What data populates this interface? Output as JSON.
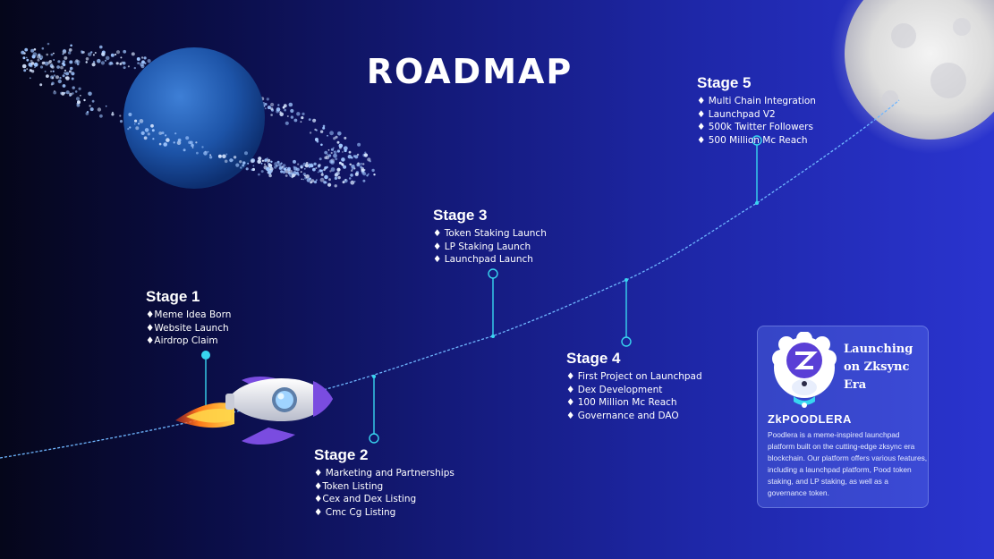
{
  "title": "ROADMAP",
  "stages": [
    {
      "title": "Stage 1",
      "items": [
        "♦Meme Idea Born",
        "♦Website Launch",
        "♦Airdrop Claim"
      ]
    },
    {
      "title": "Stage 2",
      "items": [
        "♦ Marketing and Partnerships",
        "♦Token Listing",
        "♦Cex and Dex Listing",
        "♦ Cmc Cg Listing"
      ]
    },
    {
      "title": "Stage 3",
      "items": [
        "♦ Token Staking Launch",
        "♦ LP Staking Launch",
        "♦ Launchpad Launch"
      ]
    },
    {
      "title": "Stage 4",
      "items": [
        "♦ First Project on Launchpad",
        "♦ Dex Development",
        "♦ 100 Million Mc Reach",
        "♦ Governance and DAO"
      ]
    },
    {
      "title": "Stage 5",
      "items": [
        "♦ Multi Chain Integration",
        "♦ Launchpad V2",
        "♦ 500k Twitter Followers",
        "♦ 500 Million Mc Reach"
      ]
    }
  ],
  "card": {
    "launching": "Launching on Zksync Era",
    "brand": "ZkPOODLERA",
    "description": "Poodlera is a meme-inspired launchpad platform built on the cutting-edge zksync era blockchain. Our platform offers various features, including a launchpad platform, Pood token staking, and LP staking, as well as a governance token."
  },
  "colors": {
    "accent": "#38d6f0",
    "path": "#6fb6ff",
    "rocket_body": "#e9ecf3",
    "rocket_fin": "#7a4ce0",
    "flame": "#ff7a1a"
  },
  "icons": [
    "planet-icon",
    "moon-icon",
    "rocket-icon",
    "poodle-logo-icon"
  ]
}
